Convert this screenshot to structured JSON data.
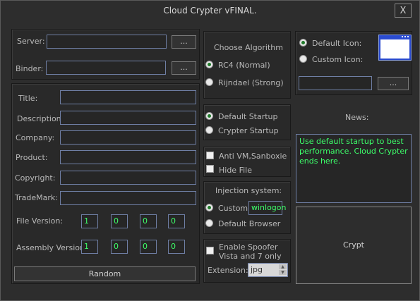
{
  "window": {
    "title": "Cloud Crypter vFINAL.",
    "close_glyph": "X"
  },
  "server": {
    "label": "Server:",
    "value": "",
    "browse": "..."
  },
  "binder": {
    "label": "Binder:",
    "value": "",
    "browse": "..."
  },
  "assembly": {
    "fields": [
      {
        "label": "Title:",
        "value": ""
      },
      {
        "label": "Description:",
        "value": ""
      },
      {
        "label": "Company:",
        "value": ""
      },
      {
        "label": "Product:",
        "value": ""
      },
      {
        "label": "Copyright:",
        "value": ""
      },
      {
        "label": "TradeMark:",
        "value": ""
      }
    ],
    "file_version": {
      "label": "File Version:",
      "values": [
        "1",
        "0",
        "0",
        "0"
      ]
    },
    "assembly_version": {
      "label": "Assembly Version:",
      "values": [
        "1",
        "0",
        "0",
        "0"
      ]
    },
    "random": "Random"
  },
  "algorithm": {
    "header": "Choose Algorithm",
    "options": [
      {
        "label": "RC4 (Normal)",
        "selected": true
      },
      {
        "label": "Rijndael (Strong)",
        "selected": false
      }
    ]
  },
  "startup": {
    "options": [
      {
        "label": "Default Startup",
        "selected": true
      },
      {
        "label": "Crypter Startup",
        "selected": false
      }
    ]
  },
  "options": {
    "anti_vm": {
      "label": "Anti VM,Sanboxie",
      "checked": false
    },
    "hide_file": {
      "label": "Hide File",
      "checked": false
    }
  },
  "injection": {
    "header": "Injection system:",
    "custom": {
      "label": "Custom:",
      "value": "winlogon",
      "selected": true
    },
    "default_browser": {
      "label": "Default Browser",
      "selected": false
    }
  },
  "spoofer": {
    "label_line1": "Enable Spoofer",
    "label_line2": "Vista and 7 only",
    "checked": false,
    "extension_label": "Extension:",
    "extension_value": "jpg"
  },
  "icon": {
    "default": {
      "label": "Default Icon:",
      "selected": true
    },
    "custom": {
      "label": "Custom Icon:",
      "selected": false
    },
    "path_value": "",
    "browse": "..."
  },
  "news": {
    "header": "News:",
    "text": "Use default startup to best performance. Cloud Crypter ends here."
  },
  "crypt": {
    "label": "Crypt"
  },
  "colors": {
    "accent_green": "#3dff6a",
    "input_border": "#6f7fa5",
    "background": "#2d2d2d"
  }
}
